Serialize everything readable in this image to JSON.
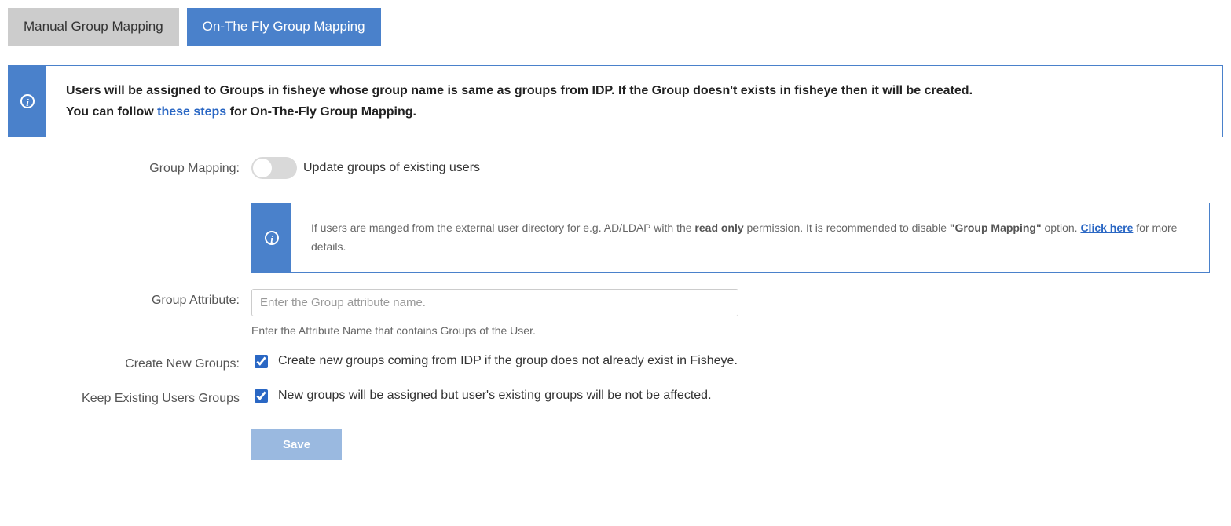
{
  "tabs": {
    "manual": "Manual Group Mapping",
    "otf": "On-The Fly Group Mapping"
  },
  "info1": {
    "line1": "Users will be assigned to Groups in fisheye whose group name is same as groups from IDP. If the Group doesn't exists in fisheye then it will be created.",
    "line2_a": "You can follow ",
    "line2_link": "these steps",
    "line2_b": " for On-The-Fly Group Mapping."
  },
  "form": {
    "group_mapping_label": "Group Mapping:",
    "group_mapping_toggle_text": "Update groups of existing users",
    "inner_info_a": "If users are manged from the external user directory for e.g. AD/LDAP with the ",
    "inner_info_b_bold": "read only",
    "inner_info_c": " permission. It is recommended to disable ",
    "inner_info_d_bold": "\"Group Mapping\"",
    "inner_info_e": " option. ",
    "inner_info_link": "Click here",
    "inner_info_f": " for more details.",
    "group_attr_label": "Group Attribute:",
    "group_attr_placeholder": "Enter the Group attribute name.",
    "group_attr_help": "Enter the Attribute Name that contains Groups of the User.",
    "create_new_label": "Create New Groups:",
    "create_new_text": "Create new groups coming from IDP if the group does not already exist in Fisheye.",
    "keep_existing_label": "Keep Existing Users Groups",
    "keep_existing_text": "New groups will be assigned but user's existing groups will be not be affected.",
    "save_label": "Save"
  }
}
